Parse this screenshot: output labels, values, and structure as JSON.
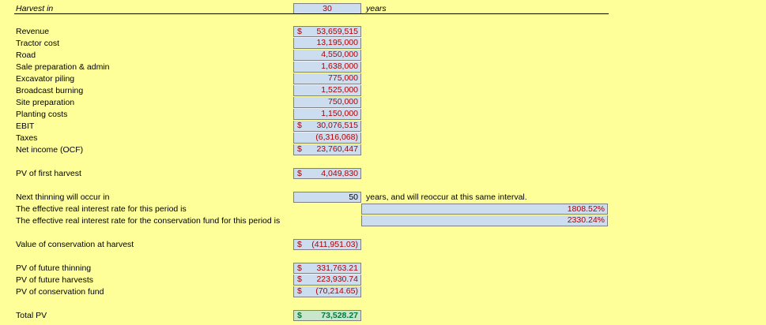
{
  "header": {
    "label": "Harvest in",
    "value": "30",
    "unit": "years"
  },
  "cashflow": [
    {
      "label": "Revenue",
      "currency": "$",
      "value": "53,659,515"
    },
    {
      "label": "Tractor cost",
      "currency": "",
      "value": "13,195,000"
    },
    {
      "label": "Road",
      "currency": "",
      "value": "4,550,000"
    },
    {
      "label": "Sale preparation & admin",
      "currency": "",
      "value": "1,638,000"
    },
    {
      "label": "Excavator piling",
      "currency": "",
      "value": "775,000"
    },
    {
      "label": "Broadcast burning",
      "currency": "",
      "value": "1,525,000"
    },
    {
      "label": "Site preparation",
      "currency": "",
      "value": "750,000"
    },
    {
      "label": "Planting costs",
      "currency": "",
      "value": "1,150,000"
    },
    {
      "label": "EBIT",
      "currency": "$",
      "value": "30,076,515"
    },
    {
      "label": "Taxes",
      "currency": "",
      "value": "(6,316,068)"
    },
    {
      "label": "Net income (OCF)",
      "currency": "$",
      "value": "23,760,447"
    }
  ],
  "pv_first": {
    "label": "PV of first harvest",
    "currency": "$",
    "value": "4,049,830"
  },
  "thinning": {
    "label": "Next thinning will occur in",
    "value": "50",
    "after_text": "years, and will reoccur at this same interval.",
    "rate1_label": "The effective real interest rate for this period is",
    "rate1_value": "1808.52%",
    "rate2_label": "The effective real interest rate for the conservation fund for this period is",
    "rate2_value": "2330.24%"
  },
  "conservation": {
    "label": "Value of conservation at harvest",
    "currency": "$",
    "value": "(411,951.03)"
  },
  "future": [
    {
      "label": "PV of future thinning",
      "currency": "$",
      "value": "331,763.21"
    },
    {
      "label": "PV of future harvests",
      "currency": "$",
      "value": "223,930.74"
    },
    {
      "label": "PV of conservation fund",
      "currency": "$",
      "value": "(70,214.65)"
    }
  ],
  "total": {
    "label": "Total PV",
    "currency": "$",
    "value": "73,528.27"
  }
}
